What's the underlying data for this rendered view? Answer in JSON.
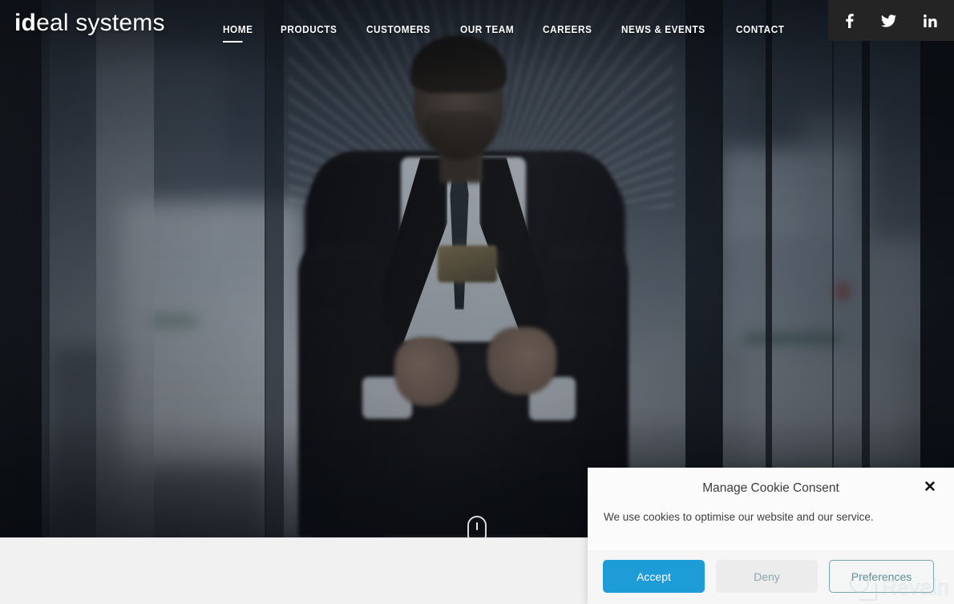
{
  "site": {
    "logo_bold": "id",
    "logo_rest": "eal systems"
  },
  "nav": {
    "items": [
      {
        "label": "HOME",
        "active": true
      },
      {
        "label": "PRODUCTS",
        "active": false
      },
      {
        "label": "CUSTOMERS",
        "active": false
      },
      {
        "label": "OUR TEAM",
        "active": false
      },
      {
        "label": "CAREERS",
        "active": false
      },
      {
        "label": "NEWS & EVENTS",
        "active": false
      },
      {
        "label": "CONTACT",
        "active": false
      }
    ]
  },
  "social": {
    "background": "#242424",
    "items": [
      {
        "name": "facebook-icon",
        "label": "Facebook"
      },
      {
        "name": "twitter-icon",
        "label": "Twitter"
      },
      {
        "name": "linkedin-icon",
        "label": "LinkedIn"
      }
    ]
  },
  "hero": {
    "scroll_indicator": "mouse-scroll-icon",
    "description": "Businessman in dark suit using a smartphone behind office glass"
  },
  "cookie": {
    "title": "Manage Cookie Consent",
    "close_label": "✕",
    "text": "We use cookies to optimise our website and our service.",
    "buttons": {
      "accept": "Accept",
      "deny": "Deny",
      "preferences": "Preferences"
    },
    "accent_color": "#1e9cd7",
    "preferences_border": "#79a6ad"
  },
  "watermark": {
    "text": "Revain"
  }
}
